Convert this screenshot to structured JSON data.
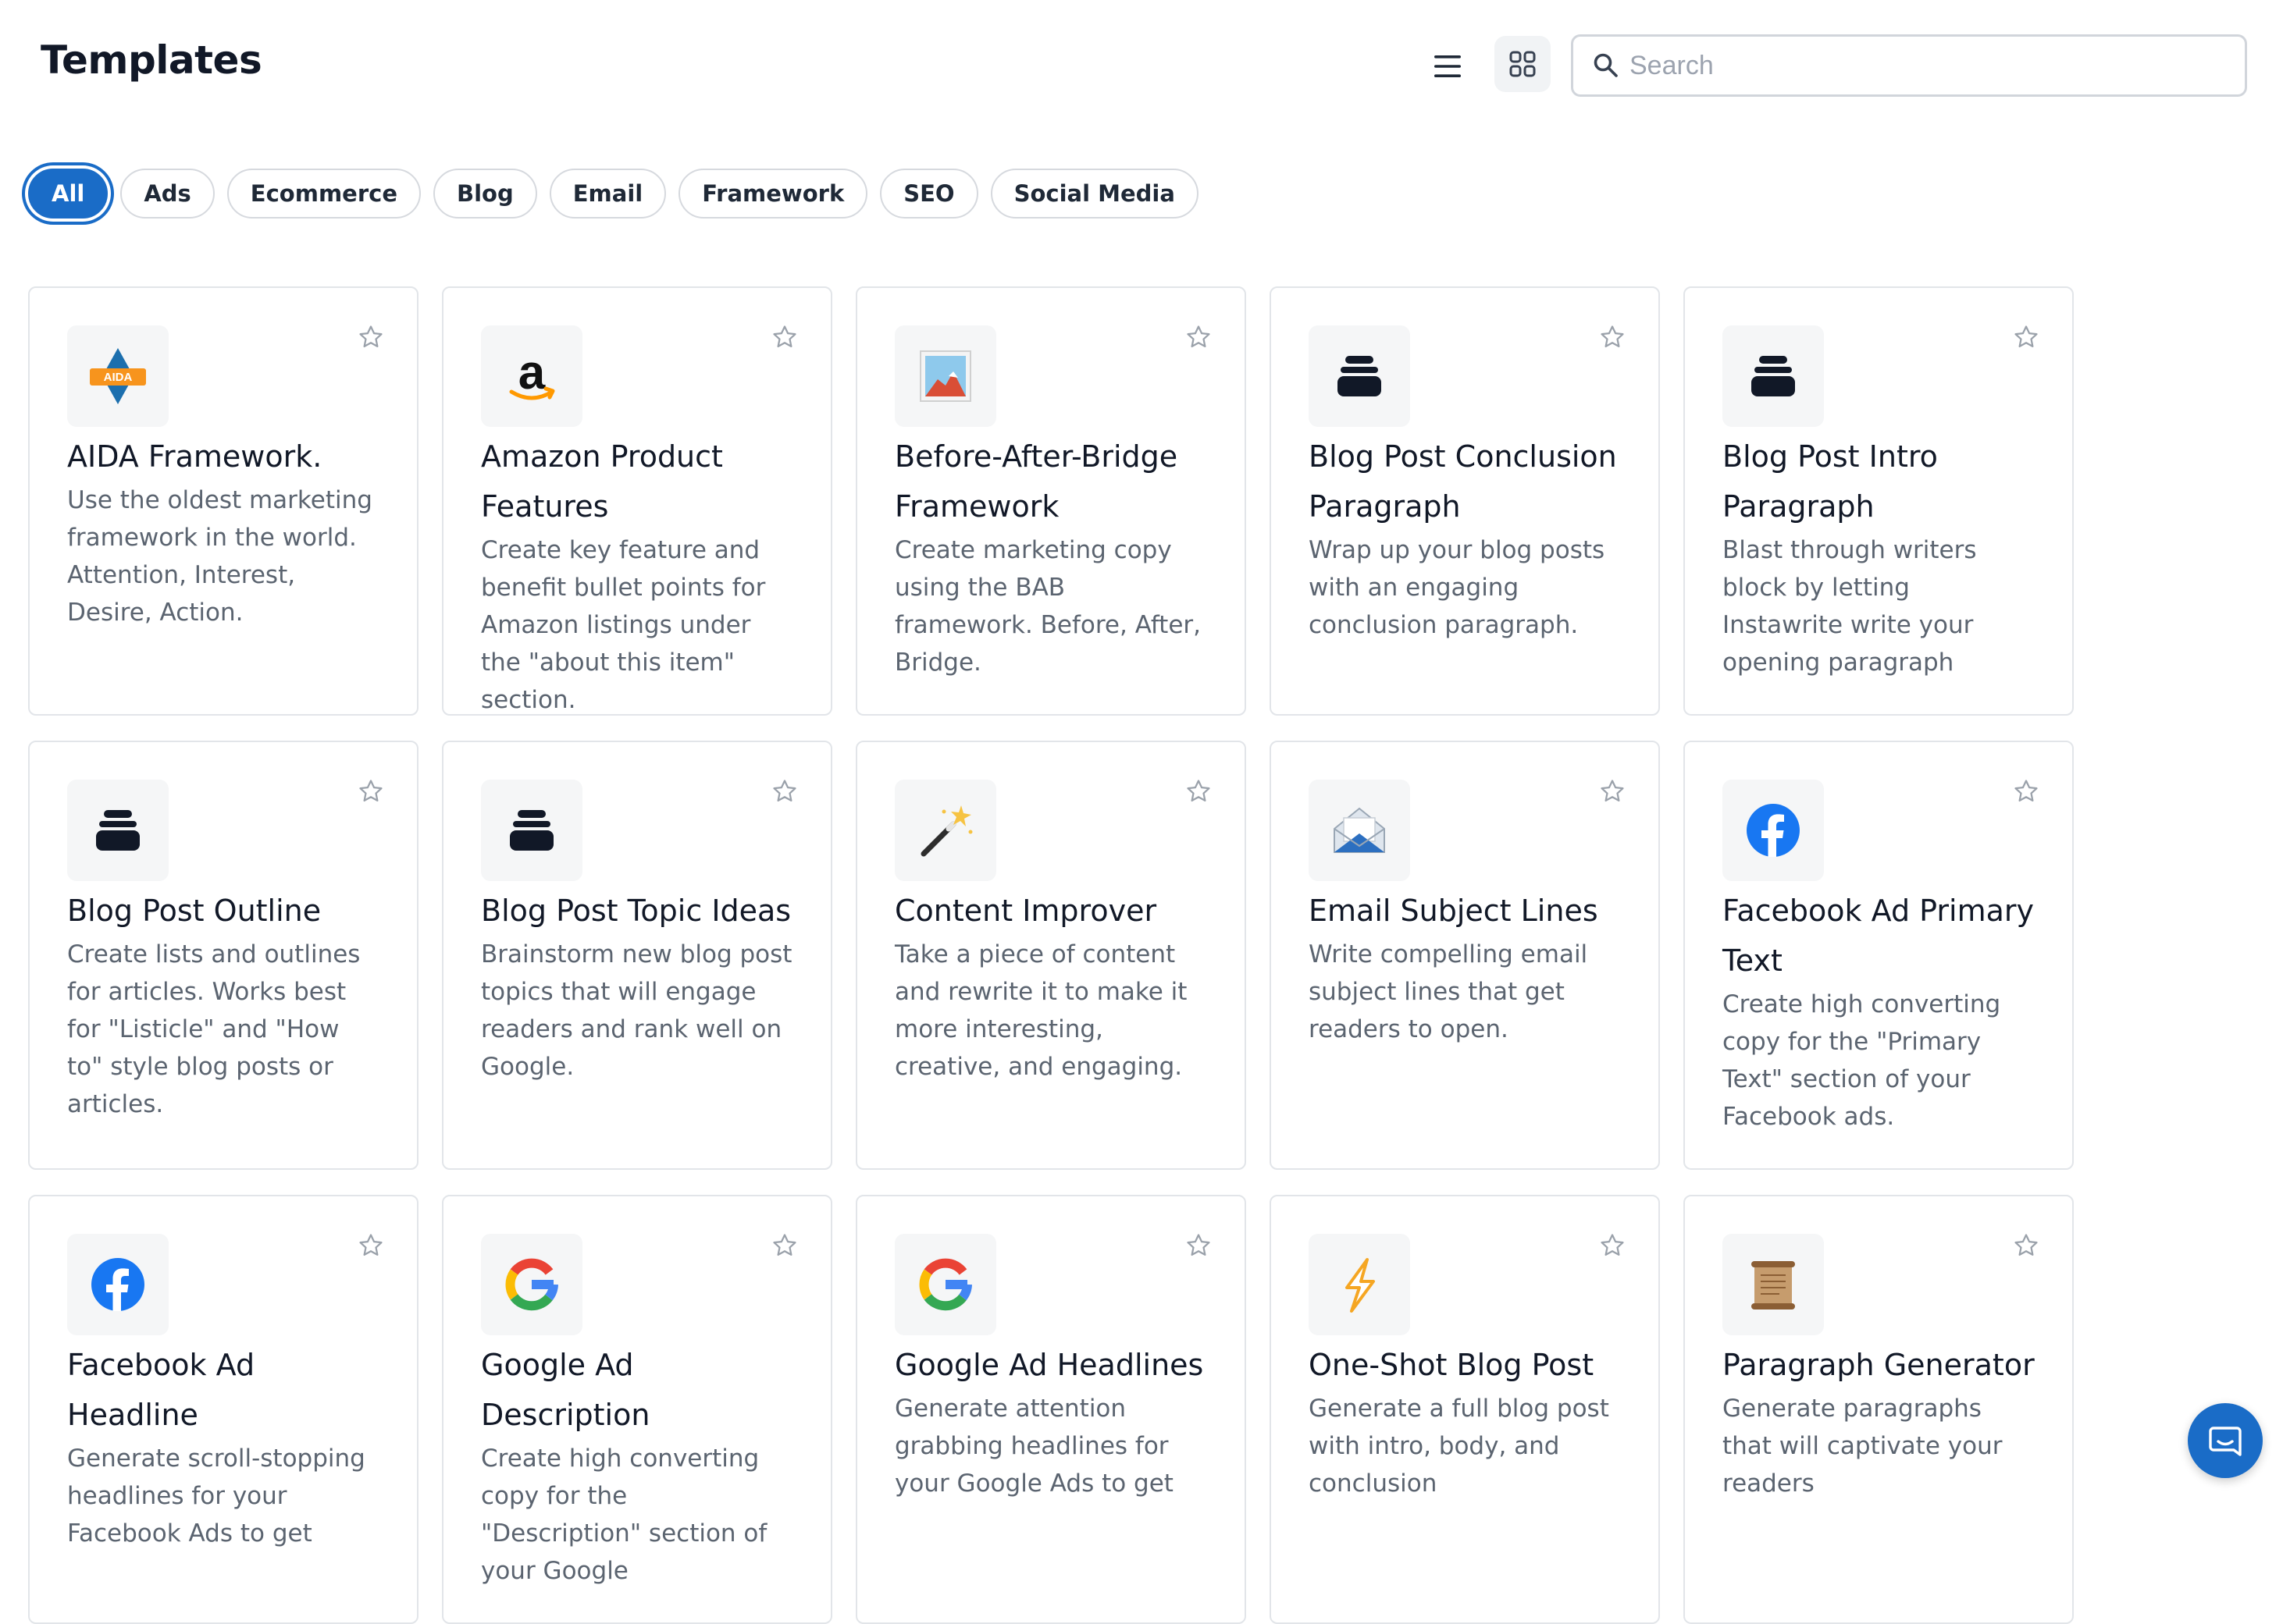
{
  "header": {
    "title": "Templates"
  },
  "search": {
    "placeholder": "Search",
    "value": ""
  },
  "filters": [
    {
      "label": "All",
      "active": true
    },
    {
      "label": "Ads",
      "active": false
    },
    {
      "label": "Ecommerce",
      "active": false
    },
    {
      "label": "Blog",
      "active": false
    },
    {
      "label": "Email",
      "active": false
    },
    {
      "label": "Framework",
      "active": false
    },
    {
      "label": "SEO",
      "active": false
    },
    {
      "label": "Social Media",
      "active": false
    }
  ],
  "templates": [
    {
      "icon": "aida-icon",
      "title": "AIDA Framework.",
      "description": "Use the oldest marketing framework in the world. Attention, Interest, Desire, Action."
    },
    {
      "icon": "amazon-icon",
      "title": "Amazon Product Features",
      "description": "Create key feature and benefit bullet points for Amazon listings under the \"about this item\" section."
    },
    {
      "icon": "picture-icon",
      "title": "Before-After-Bridge Framework",
      "description": "Create marketing copy using the BAB framework. Before, After, Bridge."
    },
    {
      "icon": "ink-icon",
      "title": "Blog Post Conclusion Paragraph",
      "description": "Wrap up your blog posts with an engaging conclusion paragraph."
    },
    {
      "icon": "ink-icon",
      "title": "Blog Post Intro Paragraph",
      "description": "Blast through writers block by letting Instawrite write your opening paragraph"
    },
    {
      "icon": "ink-icon",
      "title": "Blog Post Outline",
      "description": "Create lists and outlines for articles. Works best for \"Listicle\" and \"How to\" style blog posts or articles."
    },
    {
      "icon": "ink-icon",
      "title": "Blog Post Topic Ideas",
      "description": "Brainstorm new blog post topics that will engage readers and rank well on Google."
    },
    {
      "icon": "magic-wand-icon",
      "title": "Content Improver",
      "description": "Take a piece of content and rewrite it to make it more interesting, creative, and engaging."
    },
    {
      "icon": "envelope-icon",
      "title": "Email Subject Lines",
      "description": "Write compelling email subject lines that get readers to open."
    },
    {
      "icon": "facebook-icon",
      "title": "Facebook Ad Primary Text",
      "description": "Create high converting copy for the \"Primary Text\" section of your Facebook ads."
    },
    {
      "icon": "facebook-icon",
      "title": "Facebook Ad Headline",
      "description": "Generate scroll-stopping headlines for your Facebook Ads to get"
    },
    {
      "icon": "google-icon",
      "title": "Google Ad Description",
      "description": "Create high converting copy for the \"Description\" section of your Google"
    },
    {
      "icon": "google-icon",
      "title": "Google Ad Headlines",
      "description": "Generate attention grabbing headlines for your Google Ads to get"
    },
    {
      "icon": "lightning-icon",
      "title": "One-Shot Blog Post",
      "description": "Generate a full blog post with intro, body, and conclusion"
    },
    {
      "icon": "scroll-icon",
      "title": "Paragraph Generator",
      "description": "Generate paragraphs that will captivate your readers"
    }
  ],
  "colors": {
    "accent": "#1a6cc7",
    "border": "#e2e5e9",
    "muted_text": "#5b6470"
  }
}
